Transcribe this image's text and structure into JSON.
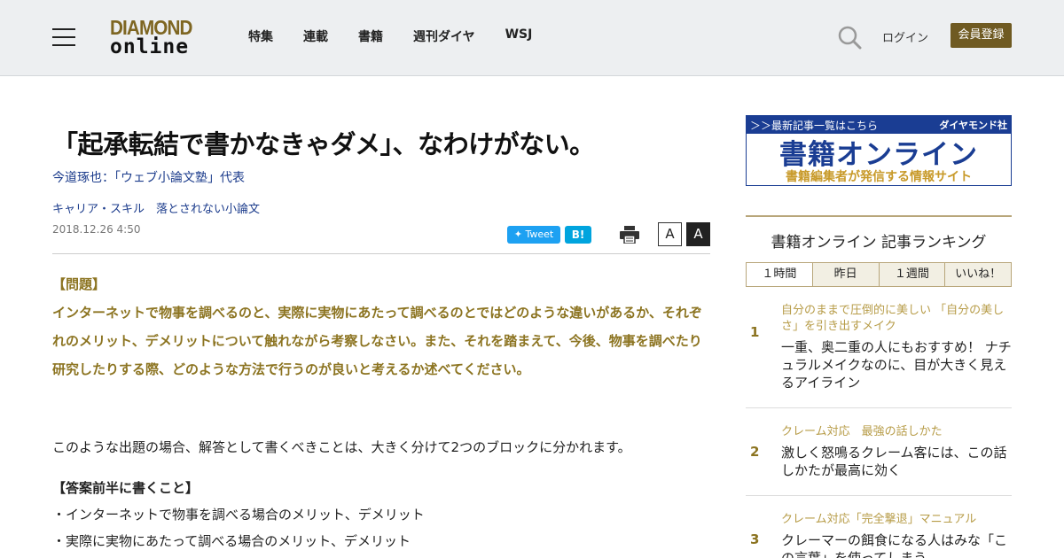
{
  "header": {
    "logo_top": "DIAMOND",
    "logo_bottom": "online",
    "nav": [
      "特集",
      "連載",
      "書籍",
      "週刊ダイヤ",
      "WSJ"
    ],
    "login": "ログイン",
    "register": "会員登録"
  },
  "article": {
    "title": "「起承転結で書かなきゃダメ」、なわけがない。",
    "author": "今道琢也：「ウェブ小論文塾」代表",
    "category": "キャリア・スキル　落とされない小論文",
    "date": "2018.12.26 4:50",
    "tweet": "Tweet",
    "hatena": "B!",
    "font_small": "A",
    "font_large": "A",
    "question_label": "【問題】",
    "question_text": "インターネットで物事を調べるのと、実際に実物にあたって調べるのとではどのような違いがあるか、それぞれのメリット、デメリットについて触れながら考察しなさい。また、それを踏まえて、今後、物事を調べたり研究したりする際、どのような方法で行うのが良いと考えるか述べてください。",
    "body_intro": "このような出題の場合、解答として書くべきことは、大きく分けて2つのブロックに分かれます。",
    "section_heading": "【答案前半に書くこと】",
    "bullets": [
      "・インターネットで物事を調べる場合のメリット、デメリット",
      "・実際に実物にあたって調べる場合のメリット、デメリット"
    ]
  },
  "sidebar": {
    "banner": {
      "top_left": "＞＞最新記事一覧はこちら",
      "top_right": "ダイヤモンド社",
      "main": "書籍オンライン",
      "sub": "書籍編集者が発信する情報サイト"
    },
    "ranking": {
      "title": "書籍オンライン 記事ランキング",
      "tabs": [
        "１時間",
        "昨日",
        "１週間",
        "いいね！"
      ],
      "items": [
        {
          "num": "1",
          "series": "自分のままで圧倒的に美しい 「自分の美しさ」を引き出すメイク",
          "headline": "一重、奥二重の人にもおすすめ！ ナチュラルメイクなのに、目が大きく見えるアイライン"
        },
        {
          "num": "2",
          "series": "クレーム対応　最強の話しかた",
          "headline": "激しく怒鳴るクレーム客には、この話しかたが最高に効く"
        },
        {
          "num": "3",
          "series": "クレーム対応「完全撃退」マニュアル",
          "headline": "クレーマーの餌食になる人はみな「この言葉」を使ってしまう"
        }
      ]
    }
  }
}
